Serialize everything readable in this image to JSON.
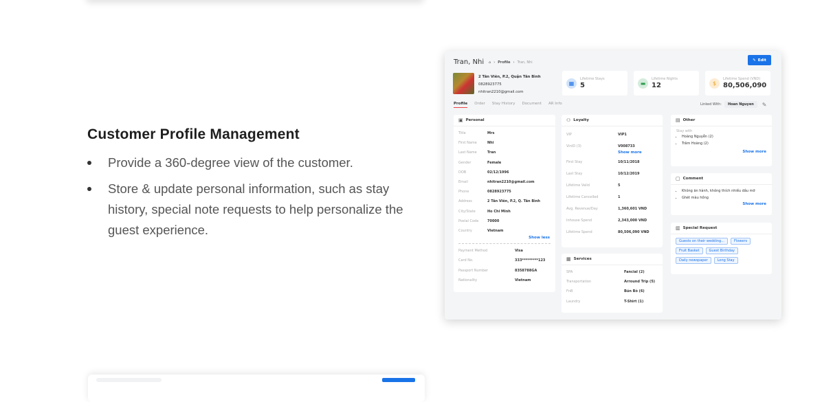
{
  "feature": {
    "heading": "Customer Profile Management",
    "bullets": [
      "Provide a 360-degree view of the customer.",
      "Store & update personal information, such as stay history, special note requests to help personalize the guest experience."
    ]
  },
  "profile": {
    "title": "Tran, Nhi",
    "breadcrumb": [
      "Profile",
      "Tran, Nhi"
    ],
    "edit_label": "Edit",
    "contact": {
      "address": "2 Tân Viên, P.2, Quận Tân Bình",
      "phone": "0828923775",
      "email": "nhitran2210@gmail.com"
    },
    "stats": [
      {
        "label": "Lifetime Stays",
        "value": "5",
        "icon": "calendar-icon",
        "color": "#1a73e8"
      },
      {
        "label": "Lifetime Nights",
        "value": "12",
        "icon": "bed-icon",
        "color": "#2e9e4f"
      },
      {
        "label": "Lifetime Spend (VND)",
        "value": "80,506,090",
        "icon": "coin-icon",
        "color": "#f0a020"
      }
    ],
    "tabs": [
      "Profile",
      "Order",
      "Stay History",
      "Document",
      "AR Info"
    ],
    "active_tab": "Profile",
    "linked_label": "Linked With:",
    "linked_value": "Hoan Nguyen",
    "personal": {
      "title": "Personal",
      "rows": [
        [
          "Title",
          "Mrs"
        ],
        [
          "First Name",
          "Nhi"
        ],
        [
          "Last Name",
          "Tran"
        ],
        [
          "Gender",
          "Female"
        ],
        [
          "DOB",
          "02/12/1996"
        ],
        [
          "Email",
          "nhitran2210@gmail.com"
        ],
        [
          "Phone",
          "0828923775"
        ],
        [
          "Address",
          "2 Tân Viên, P.2, Q. Tân Bình"
        ],
        [
          "City/State",
          "Ho Chi Minh"
        ],
        [
          "Postal Code",
          "70000"
        ],
        [
          "Country",
          "Vietnam"
        ]
      ],
      "show_less": "Show less",
      "payment_rows": [
        [
          "Payment Method",
          "Visa"
        ],
        [
          "Card No.",
          "333*********123"
        ],
        [
          "Passport Number",
          "8358788GA"
        ],
        [
          "Nationality",
          "Vietnam"
        ]
      ]
    },
    "loyalty": {
      "title": "Loyalty",
      "rows_top": [
        [
          "VIP",
          "VIP1"
        ],
        [
          "VinID (3)",
          "V008733"
        ]
      ],
      "show_more": "Show more",
      "rows": [
        [
          "First Stay",
          "10/11/2018"
        ],
        [
          "Last Stay",
          "10/12/2019"
        ],
        [
          "Lifetime Valid",
          "5"
        ],
        [
          "Lifetime Cancelled",
          "1"
        ],
        [
          "Avg. Revenue/Day",
          "1,360,601 VND"
        ],
        [
          "Inhouse Spend",
          "2,343,000 VND"
        ],
        [
          "Lifetime Spend",
          "80,506,090 VND"
        ]
      ]
    },
    "services": {
      "title": "Services",
      "rows": [
        [
          "SPA",
          "Fancial (2)"
        ],
        [
          "Transportation",
          "Arround Trip (5)"
        ],
        [
          "FnB",
          "Bún Bò (6)"
        ],
        [
          "Laundry",
          "T-Shirt (1)"
        ]
      ]
    },
    "other": {
      "title": "Other",
      "label": "Stay with",
      "items": [
        "Hoàng Nguyễn (2)",
        "Trâm Hoàng (2)"
      ],
      "show_more": "Show more"
    },
    "comment": {
      "title": "Comment",
      "items": [
        "Không ăn hành, không thích nhiều dầu mỡ",
        "Ghét màu hồng"
      ],
      "show_more": "Show more"
    },
    "special": {
      "title": "Special Request",
      "tags": [
        "Guests on their wedding...",
        "Flowers",
        "Fruit Basket",
        "Guest Birthday",
        "Daily newspaper",
        "Long Stay"
      ]
    }
  }
}
